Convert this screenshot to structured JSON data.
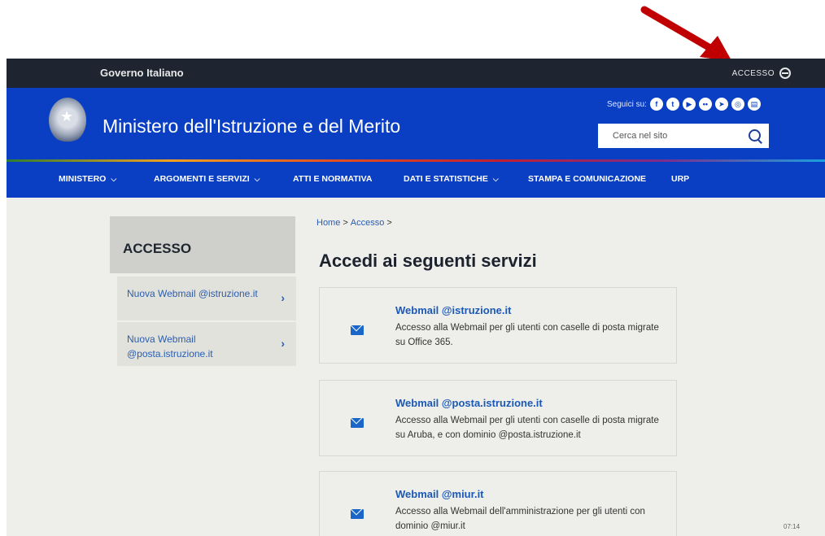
{
  "topbar": {
    "governo_label": "Governo Italiano",
    "login_label": "ACCESSO"
  },
  "header": {
    "site_title": "Ministero dell'Istruzione e del Merito",
    "follow_label": "Seguici su:",
    "social_icons": [
      "facebook-icon",
      "twitter-icon",
      "youtube-icon",
      "flickr-icon",
      "telegram-icon",
      "instagram-icon",
      "rss-icon"
    ],
    "search_placeholder": "Cerca nel sito",
    "accent_color": "#0a3fc4"
  },
  "nav": [
    {
      "label": "MINISTERO",
      "dropdown": true
    },
    {
      "label": "ARGOMENTI E SERVIZI",
      "dropdown": true
    },
    {
      "label": "ATTI E NORMATIVA",
      "dropdown": false
    },
    {
      "label": "DATI E STATISTICHE",
      "dropdown": true
    },
    {
      "label": "STAMPA E COMUNICAZIONE",
      "dropdown": false
    },
    {
      "label": "URP",
      "dropdown": false
    }
  ],
  "sidebar": {
    "title": "ACCESSO",
    "items": [
      {
        "label": "Nuova Webmail @istruzione.it"
      },
      {
        "label": "Nuova Webmail @posta.istruzione.it"
      }
    ]
  },
  "breadcrumb": {
    "home": "Home",
    "current": "Accesso",
    "separator": ">"
  },
  "main": {
    "title": "Accedi ai seguenti servizi",
    "services": [
      {
        "title": "Webmail @istruzione.it",
        "description": "Accesso alla Webmail per gli utenti con caselle di posta migrate su Office 365."
      },
      {
        "title": "Webmail @posta.istruzione.it",
        "description": "Accesso alla Webmail per gli utenti con caselle di posta migrate su Aruba, e con dominio @posta.istruzione.it"
      },
      {
        "title": "Webmail @miur.it",
        "description": "Accesso alla Webmail dell'amministrazione per gli utenti con dominio @miur.it"
      }
    ]
  },
  "annotation": {
    "arrow_color": "#c00000"
  },
  "taskbar_clock": "07:14"
}
